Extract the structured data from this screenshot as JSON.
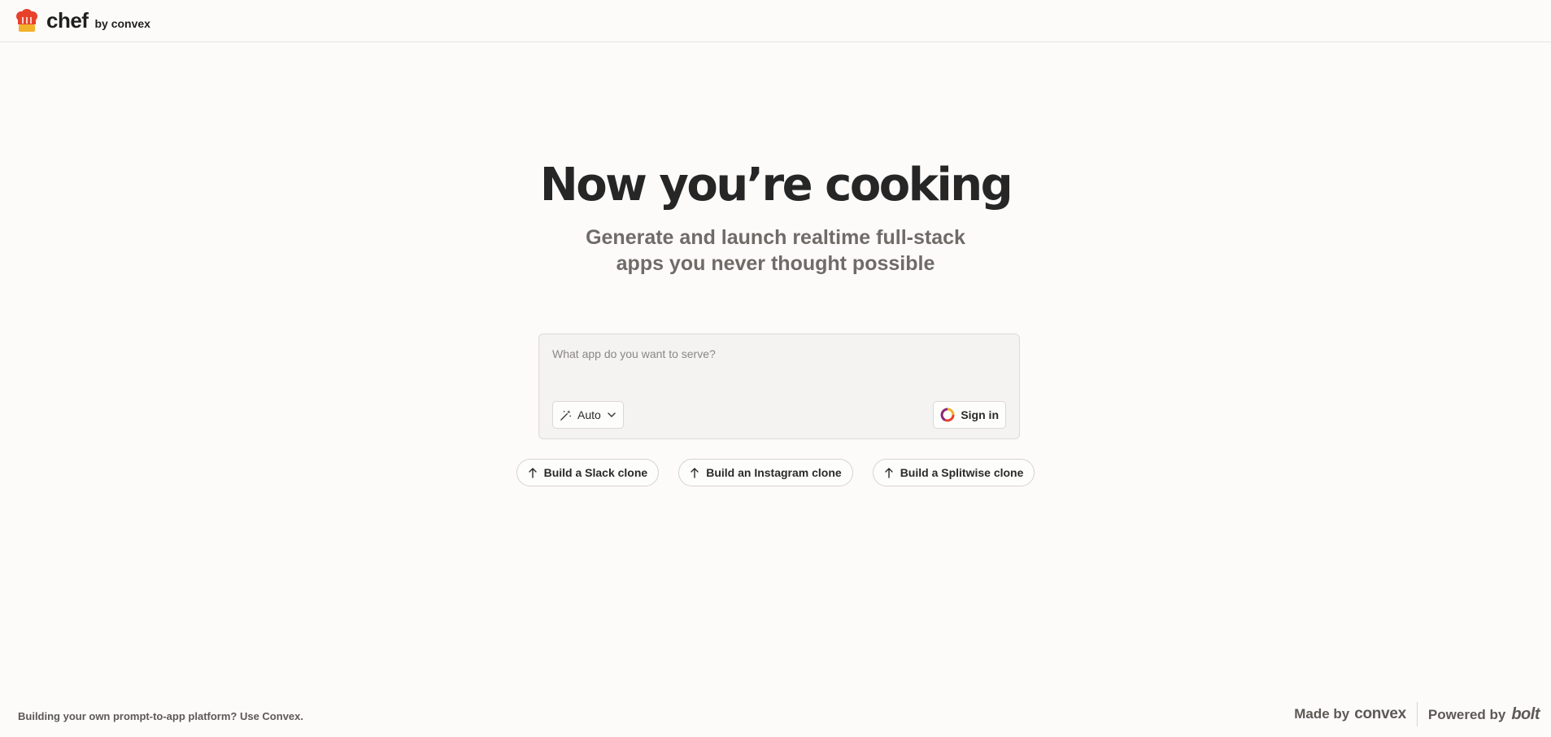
{
  "header": {
    "logo_text": "chef",
    "logo_subtext": "by convex"
  },
  "hero": {
    "title": "Now you’re cooking",
    "subtitle_line1": "Generate and launch realtime full-stack",
    "subtitle_line2": "apps you never thought possible"
  },
  "composer": {
    "placeholder": "What app do you want to serve?",
    "value": "",
    "model_label": "Auto",
    "signin_label": "Sign in"
  },
  "suggestions": [
    {
      "label": "Build a Slack clone"
    },
    {
      "label": "Build an Instagram clone"
    },
    {
      "label": "Build a Splitwise clone"
    }
  ],
  "footer": {
    "left_text": "Building your own prompt-to-app platform? Use Convex.",
    "made_by": "Made by",
    "made_by_brand": "convex",
    "powered_by": "Powered by",
    "powered_by_brand": "bolt"
  },
  "icons": {
    "logo": "chef-hat-icon",
    "auto": "magic-wand-icon",
    "auto_chevron": "chevron-down-icon",
    "signin": "convex-ring-icon",
    "suggestion": "arrow-up-icon"
  },
  "colors": {
    "background": "#fcfbfa",
    "hat_red": "#e8412b",
    "hat_band": "#f3b12b",
    "text_dark": "#262626",
    "text_muted": "#6f6b67"
  }
}
